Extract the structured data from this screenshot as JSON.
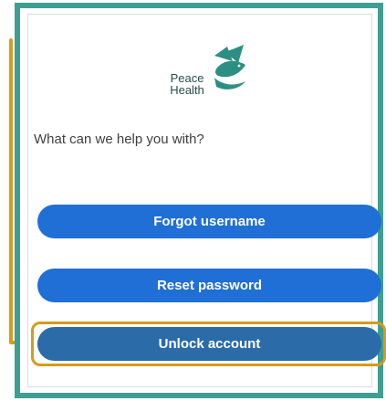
{
  "logo": {
    "line1": "Peace",
    "line2": "Health"
  },
  "prompt": "What can we help you with?",
  "buttons": [
    {
      "label": "Forgot username"
    },
    {
      "label": "Reset password"
    },
    {
      "label": "Unlock account"
    }
  ],
  "colors": {
    "frame": "#3e9e92",
    "button": "#1f6fd6",
    "highlight": "#d79b1b",
    "logo_teal": "#2d8f84"
  },
  "icons": {
    "logo": "dove-logo-icon",
    "callout": "arrow-right-icon"
  }
}
